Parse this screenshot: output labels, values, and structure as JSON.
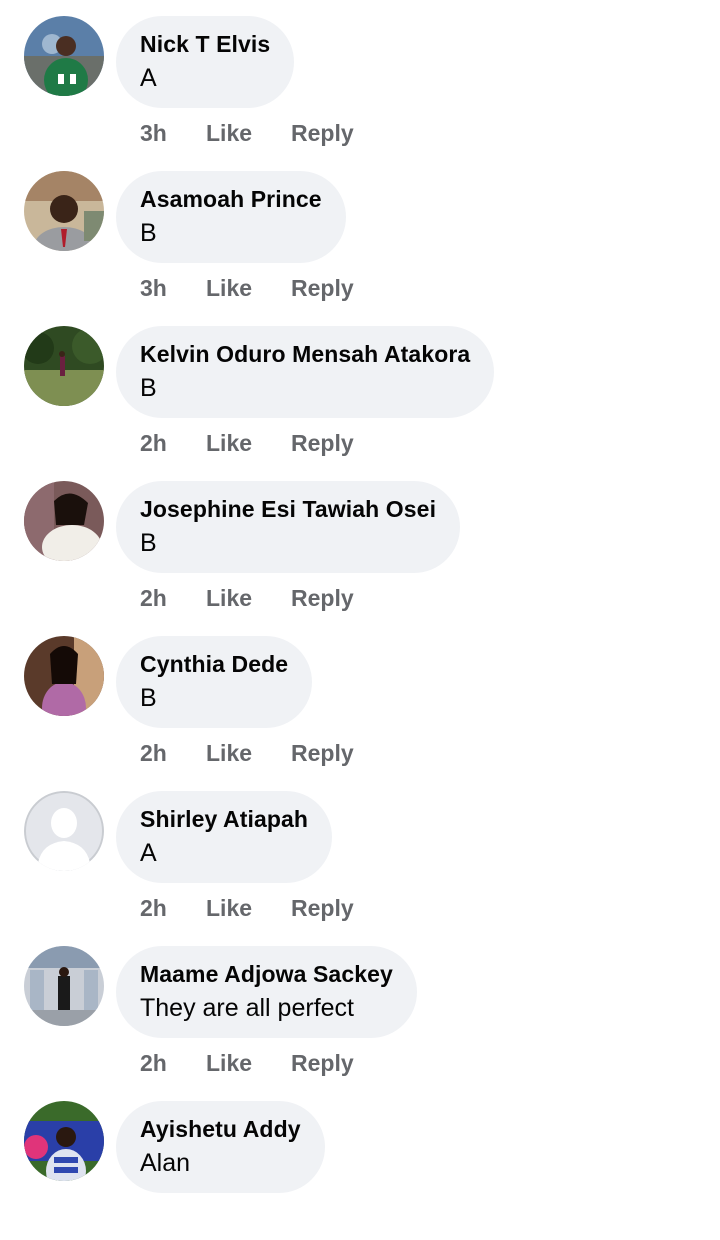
{
  "comments": [
    {
      "name": "Nick T Elvis",
      "text": "A",
      "time": "3h",
      "like": "Like",
      "reply": "Reply"
    },
    {
      "name": "Asamoah Prince",
      "text": "B",
      "time": "3h",
      "like": "Like",
      "reply": "Reply"
    },
    {
      "name": "Kelvin Oduro Mensah Atakora",
      "text": "B",
      "time": "2h",
      "like": "Like",
      "reply": "Reply"
    },
    {
      "name": "Josephine Esi Tawiah Osei",
      "text": "B",
      "time": "2h",
      "like": "Like",
      "reply": "Reply"
    },
    {
      "name": "Cynthia Dede",
      "text": "B",
      "time": "2h",
      "like": "Like",
      "reply": "Reply"
    },
    {
      "name": "Shirley Atiapah",
      "text": "A",
      "time": "2h",
      "like": "Like",
      "reply": "Reply"
    },
    {
      "name": "Maame Adjowa Sackey",
      "text": "They are all perfect",
      "time": "2h",
      "like": "Like",
      "reply": "Reply"
    },
    {
      "name": "Ayishetu Addy",
      "text": "Alan",
      "time": "",
      "like": "",
      "reply": ""
    }
  ],
  "colors": {
    "bubble": "#f0f2f5",
    "meta": "#65676b",
    "text": "#050505"
  },
  "icons": {
    "default_avatar": "person-silhouette-icon"
  }
}
